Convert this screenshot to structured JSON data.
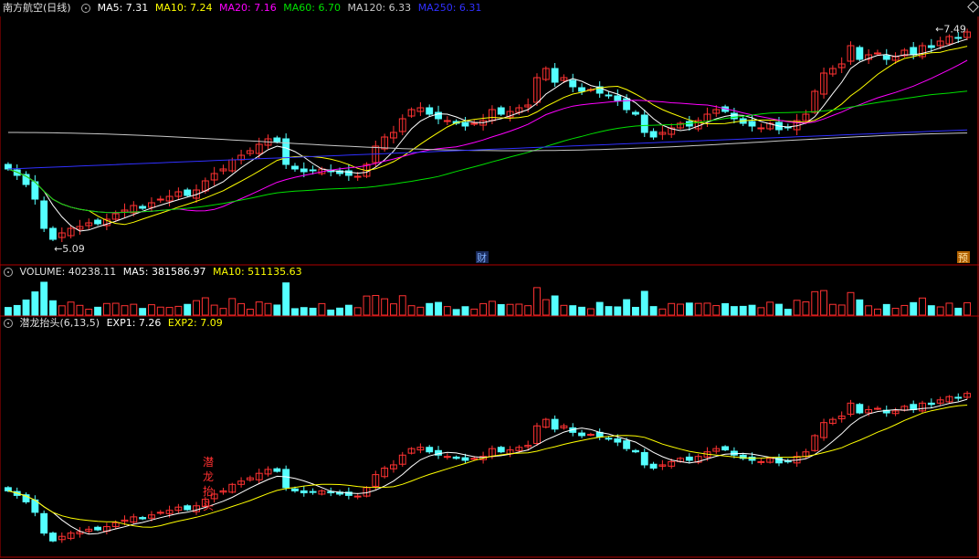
{
  "header_main": {
    "title": "南方航空(日线)",
    "ma5": "MA5: 7.31",
    "ma10": "MA10: 7.24",
    "ma20": "MA20: 7.16",
    "ma60": "MA60: 6.70",
    "ma120": "MA120: 6.33",
    "ma250": "MA250: 6.31"
  },
  "header_volume": {
    "title": "VOLUME: 40238.11",
    "ma5": "MA5: 381586.97",
    "ma10": "MA10: 511135.63"
  },
  "header_indicator": {
    "title": "潜龙抬头(6,13,5)",
    "exp1": "EXP1: 7.26",
    "exp2": "EXP2: 7.09"
  },
  "annotations": {
    "high_label": "7.49",
    "low_label": "5.09",
    "badge_cai": "财",
    "badge_yu": "预",
    "signal_text": "潜龙抬头"
  },
  "colors": {
    "up": "#ff3232",
    "down": "#54ffff",
    "ma5": "#ffffff",
    "ma10": "#ffff00",
    "ma20": "#ff00ff",
    "ma60": "#00e000",
    "ma120": "#c8c8c8",
    "ma250": "#3030ff",
    "grid": "#b00000"
  },
  "chart_data": {
    "type": "candlestick",
    "close": [
      5.95,
      5.88,
      5.78,
      5.62,
      5.3,
      5.18,
      5.25,
      5.3,
      5.32,
      5.36,
      5.35,
      5.4,
      5.46,
      5.5,
      5.55,
      5.52,
      5.58,
      5.62,
      5.65,
      5.7,
      5.66,
      5.72,
      5.82,
      5.9,
      5.95,
      6.05,
      6.1,
      6.15,
      6.22,
      6.28,
      6.25,
      6.0,
      5.95,
      5.92,
      5.93,
      5.95,
      5.92,
      5.9,
      5.88,
      5.87,
      6.0,
      6.2,
      6.3,
      6.35,
      6.5,
      6.6,
      6.62,
      6.55,
      6.5,
      6.48,
      6.45,
      6.42,
      6.45,
      6.48,
      6.6,
      6.55,
      6.58,
      6.62,
      6.65,
      6.95,
      7.05,
      6.9,
      6.95,
      6.85,
      6.8,
      6.82,
      6.78,
      6.75,
      6.7,
      6.6,
      6.55,
      6.35,
      6.3,
      6.35,
      6.4,
      6.45,
      6.42,
      6.48,
      6.55,
      6.6,
      6.58,
      6.5,
      6.45,
      6.42,
      6.4,
      6.45,
      6.38,
      6.4,
      6.48,
      6.55,
      6.8,
      7.0,
      7.05,
      7.1,
      7.3,
      7.15,
      7.2,
      7.22,
      7.15,
      7.18,
      7.25,
      7.2,
      7.3,
      7.28,
      7.35,
      7.4,
      7.38,
      7.45
    ],
    "volume_ma5_ma10_note": "",
    "annotations": [
      "7.49",
      "5.09"
    ],
    "series": [
      {
        "name": "MA5",
        "last": 7.31
      },
      {
        "name": "MA10",
        "last": 7.24
      },
      {
        "name": "MA20",
        "last": 7.16
      },
      {
        "name": "MA60",
        "last": 6.7
      },
      {
        "name": "MA120",
        "last": 6.33
      },
      {
        "name": "MA250",
        "last": 6.31
      }
    ],
    "ylim": [
      5.0,
      7.6
    ]
  }
}
